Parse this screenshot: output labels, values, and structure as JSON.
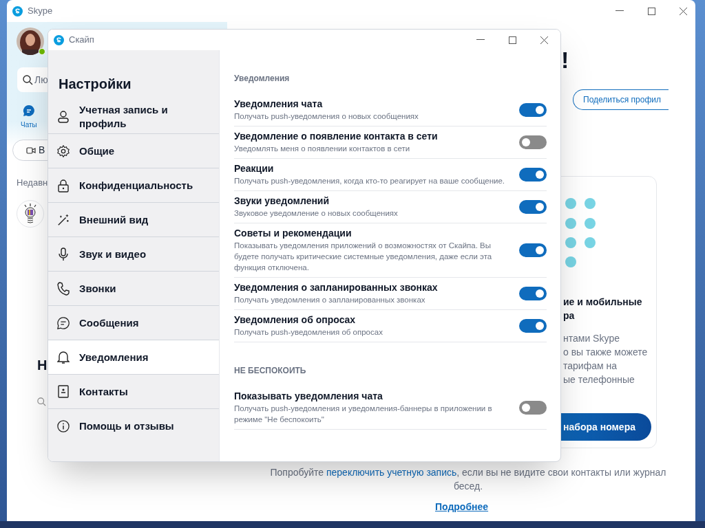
{
  "main_window": {
    "title": "Skype",
    "search": {
      "placeholder": "Лю"
    },
    "nav": [
      {
        "label": "Чаты",
        "selected": true
      }
    ],
    "meet_button": "В",
    "recent_heading": "Недавн",
    "heading_left": "Н",
    "heading_right": "!",
    "share_button": "Поделиться профил",
    "card": {
      "title_lines": [
        "ие и мобильные",
        "ра"
      ],
      "text_lines": [
        "нтами Skype",
        "о вы также можете",
        "тарифам на",
        "ые телефонные"
      ],
      "button": "набора номера"
    },
    "footer": {
      "text_before": "Попробуйте",
      "link": "переключить учетную запись",
      "text_after": ", если вы не видите свои контакты или журнал бесед.",
      "more_link": "Подробнее"
    }
  },
  "settings_dialog": {
    "title": "Скайп",
    "heading": "Настройки",
    "menu": [
      {
        "label": "Учетная запись и профиль",
        "selected": false
      },
      {
        "label": "Общие",
        "selected": false
      },
      {
        "label": "Конфиденциальность",
        "selected": false
      },
      {
        "label": "Внешний вид",
        "selected": false
      },
      {
        "label": "Звук и видео",
        "selected": false
      },
      {
        "label": "Звонки",
        "selected": false
      },
      {
        "label": "Сообщения",
        "selected": false
      },
      {
        "label": "Уведомления",
        "selected": true
      },
      {
        "label": "Контакты",
        "selected": false
      },
      {
        "label": "Помощь и отзывы",
        "selected": false
      }
    ],
    "sections": [
      {
        "title": "Уведомления",
        "items": [
          {
            "title": "Уведомления чата",
            "description": "Получать push-уведомления о новых сообщениях",
            "on": true
          },
          {
            "title": "Уведомление о появление контакта в сети",
            "description": "Уведомлять меня о появлении контактов в сети",
            "on": false
          },
          {
            "title": "Реакции",
            "description": "Получать push-уведомления, когда кто-то реагирует на ваше сообщение.",
            "on": true
          },
          {
            "title": "Звуки уведомлений",
            "description": "Звуковое уведомление о новых сообщениях",
            "on": true
          },
          {
            "title": "Советы и рекомендации",
            "description": "Показывать уведомления приложений о возможностях от Скайпа. Вы будете получать критические системные уведомления, даже если эта функция отключена.",
            "on": true
          },
          {
            "title": "Уведомления о запланированных звонках",
            "description": "Получать уведомления о запланированных звонках",
            "on": true
          },
          {
            "title": "Уведомления об опросах",
            "description": "Получать push-уведомления об опросах",
            "on": true
          }
        ]
      },
      {
        "title": "НЕ БЕСПОКОИТЬ",
        "items": [
          {
            "title": "Показывать уведомления чата",
            "description": "Получать push-уведомления и уведомления-баннеры в приложении в режиме \"Не беспокоить\"",
            "on": false
          }
        ]
      }
    ]
  }
}
